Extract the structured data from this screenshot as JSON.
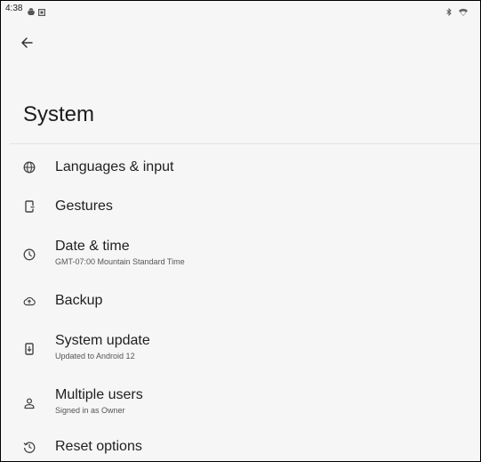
{
  "status_bar": {
    "time": "4:38",
    "left_icons": [
      "android-icon",
      "notification-icon"
    ],
    "right_icons": [
      "bluetooth-icon",
      "wifi-icon"
    ]
  },
  "header": {
    "back_icon": "arrow-left-icon",
    "title": "System"
  },
  "settings": [
    {
      "title": "Languages & input",
      "summary": "",
      "icon": "globe-icon"
    },
    {
      "title": "Gestures",
      "summary": "",
      "icon": "phone-gesture-icon"
    },
    {
      "title": "Date & time",
      "summary": "GMT-07:00 Mountain Standard Time",
      "icon": "clock-icon"
    },
    {
      "title": "Backup",
      "summary": "",
      "icon": "cloud-upload-icon"
    },
    {
      "title": "System update",
      "summary": "Updated to Android 12",
      "icon": "system-update-icon"
    },
    {
      "title": "Multiple users",
      "summary": "Signed in as Owner",
      "icon": "person-icon"
    },
    {
      "title": "Reset options",
      "summary": "",
      "icon": "history-icon"
    }
  ]
}
